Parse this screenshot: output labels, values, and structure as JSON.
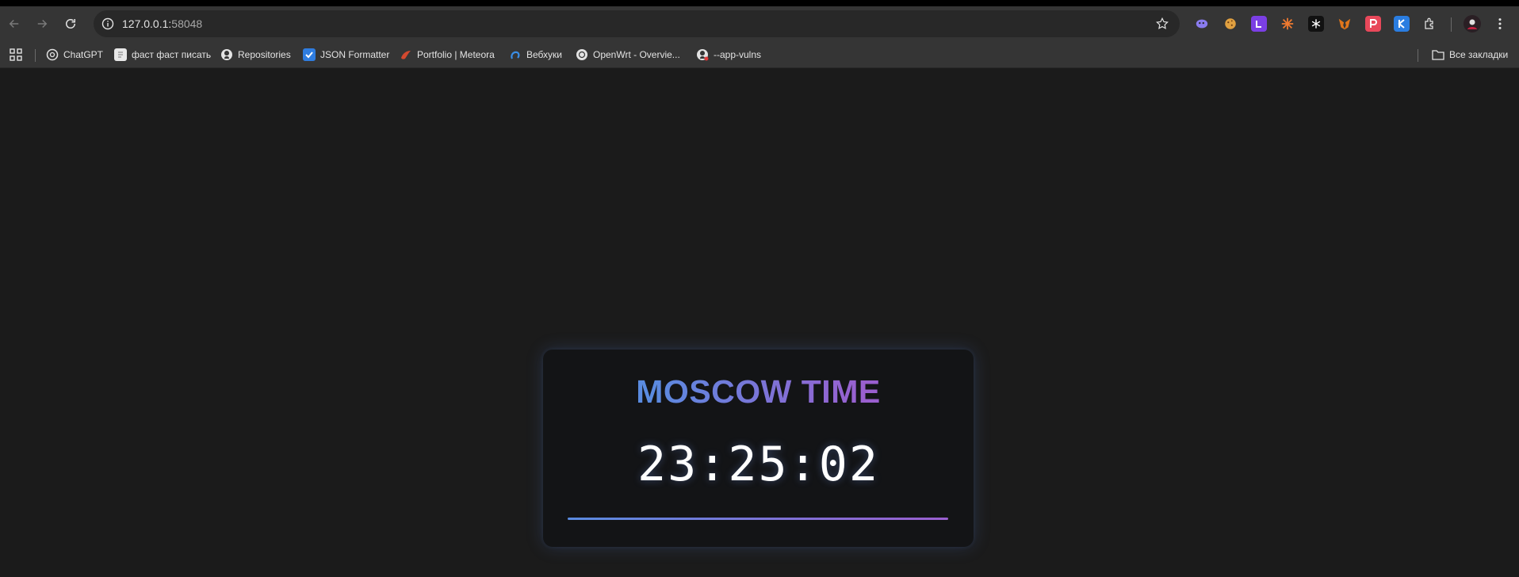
{
  "browser": {
    "url_host": "127.0.0.1:",
    "url_port": "58048"
  },
  "bookmarks": [
    {
      "label": "ChatGPT",
      "icon": "chatgpt-icon"
    },
    {
      "label": "фаст фаст писать",
      "icon": "page-icon"
    },
    {
      "label": "Repositories",
      "icon": "github-icon"
    },
    {
      "label": "JSON Formatter",
      "icon": "checkbox-icon"
    },
    {
      "label": "Portfolio | Meteora",
      "icon": "meteora-icon"
    },
    {
      "label": "Вебхуки",
      "icon": "webhook-icon"
    },
    {
      "label": "OpenWrt - Overvie...",
      "icon": "openwrt-icon"
    },
    {
      "label": "--app-vulns",
      "icon": "github-icon"
    }
  ],
  "all_bookmarks_label": "Все закладки",
  "clock": {
    "title": "MOSCOW TIME",
    "time": "23:25:02"
  },
  "colors": {
    "accent_start": "#5a8be0",
    "accent_end": "#9a5fcf",
    "background": "#1b1b1b",
    "card": "#131416"
  }
}
